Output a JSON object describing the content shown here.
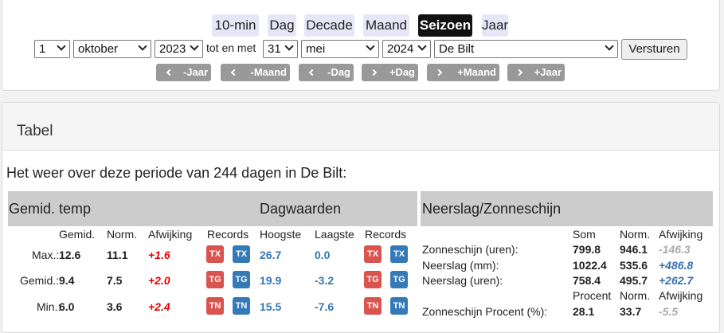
{
  "tabs": [
    "10-min",
    "Dag",
    "Decade",
    "Maand",
    "Seizoen",
    "Jaar"
  ],
  "active_tab": "Seizoen",
  "form": {
    "from_day": "1",
    "from_month": "oktober",
    "from_year": "2023",
    "to_label": "tot en met",
    "to_day": "31",
    "to_month": "mei",
    "to_year": "2024",
    "station": "De Bilt",
    "submit": "Versturen"
  },
  "nav": [
    "-Jaar",
    "-Maand",
    "-Dag",
    "+Dag",
    "+Maand",
    "+Jaar"
  ],
  "panel_title": "Tabel",
  "intro": "Het weer over deze periode van 244 dagen in De Bilt:",
  "bars": {
    "temp": "Gemid. temp",
    "day": "Dagwaarden",
    "precip": "Neerslag/Zonneschijn"
  },
  "temp_headers": {
    "gemid": "Gemid.",
    "norm": "Norm.",
    "afw": "Afwijking",
    "records": "Records",
    "hoogste": "Hoogste",
    "laagste": "Laagste",
    "records2": "Records"
  },
  "temp_rows": [
    {
      "label": "Max.:",
      "gemid": "12.6",
      "norm": "11.1",
      "afw": "+1.6",
      "b1": "TX",
      "b2": "TX",
      "hoog": "26.7",
      "laag": "0.0",
      "b3": "TX",
      "b4": "TX"
    },
    {
      "label": "Gemid.:",
      "gemid": "9.4",
      "norm": "7.5",
      "afw": "+2.0",
      "b1": "TG",
      "b2": "TG",
      "hoog": "19.9",
      "laag": "-3.2",
      "b3": "TG",
      "b4": "TG"
    },
    {
      "label": "Min.:",
      "gemid": "6.0",
      "norm": "3.6",
      "afw": "+2.4",
      "b1": "TN",
      "b2": "TN",
      "hoog": "15.5",
      "laag": "-7.6",
      "b3": "TN",
      "b4": "TN"
    }
  ],
  "precip_headers": {
    "som": "Som",
    "norm": "Norm.",
    "afw": "Afwijking"
  },
  "precip_rows": [
    {
      "label": "Zonneschijn (uren):",
      "som": "799.8",
      "norm": "946.1",
      "afw": "-146.3"
    },
    {
      "label": "Neerslag (mm):",
      "som": "1022.4",
      "norm": "535.6",
      "afw": "+486.8"
    },
    {
      "label": "Neerslag (uren):",
      "som": "758.4",
      "norm": "495.7",
      "afw": "+262.7"
    }
  ],
  "precip_headers2": {
    "procent": "Procent",
    "norm": "Norm.",
    "afw": "Afwijking"
  },
  "precip_row4": {
    "label": "Zonneschijn Procent (%):",
    "som": "28.1",
    "norm": "33.7",
    "afw": "-5.5"
  }
}
